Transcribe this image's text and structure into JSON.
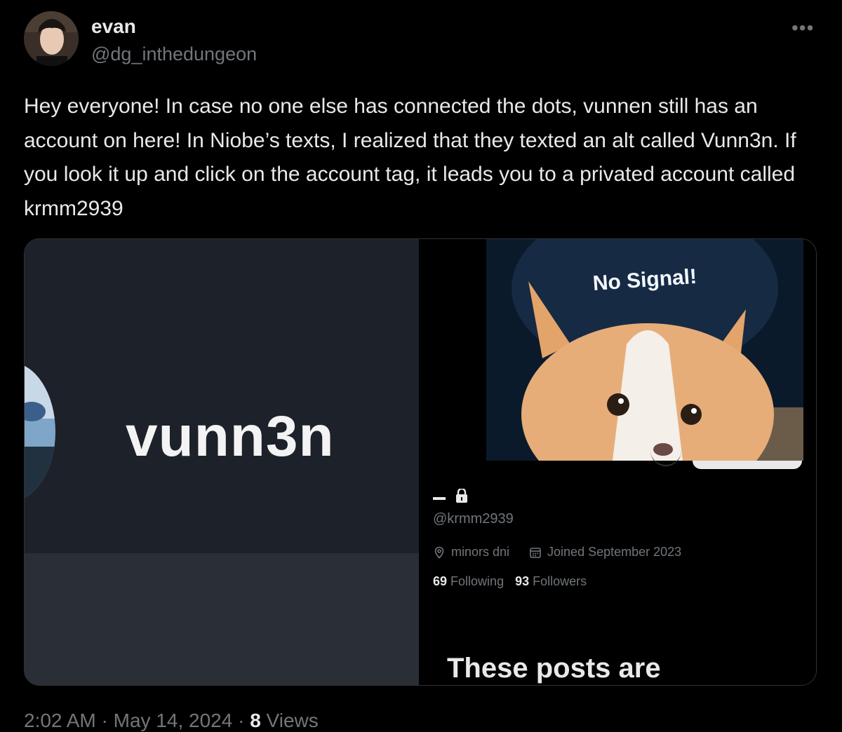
{
  "author": {
    "display_name": "evan",
    "handle": "@dg_inthedungeon"
  },
  "more_icon": "more-horizontal-icon",
  "tweet_text": "Hey everyone! In case no one else has connected the dots, vunnen still has an account on here! In Niobe’s texts, I realized that they texted an alt called Vunn3n. If you look it up and click on the account tag, it leads you to a privated account called krmm2939",
  "media": {
    "left_image": {
      "username_text": "vunn3n"
    },
    "right_image": {
      "banner_text": "No Signal!",
      "profile_name": "_",
      "lock_icon": "lock-icon",
      "profile_handle": "@krmm2939",
      "location_icon": "location-pin-icon",
      "location": "minors dni",
      "calendar_icon": "calendar-icon",
      "joined": "Joined September 2023",
      "following_count": "69",
      "following_label": "Following",
      "followers_count": "93",
      "followers_label": "Followers",
      "posts_text": "These posts are"
    }
  },
  "footer": {
    "time": "2:02 AM",
    "separator": "·",
    "date": "May 14, 2024",
    "views_count": "8",
    "views_label": "Views"
  }
}
